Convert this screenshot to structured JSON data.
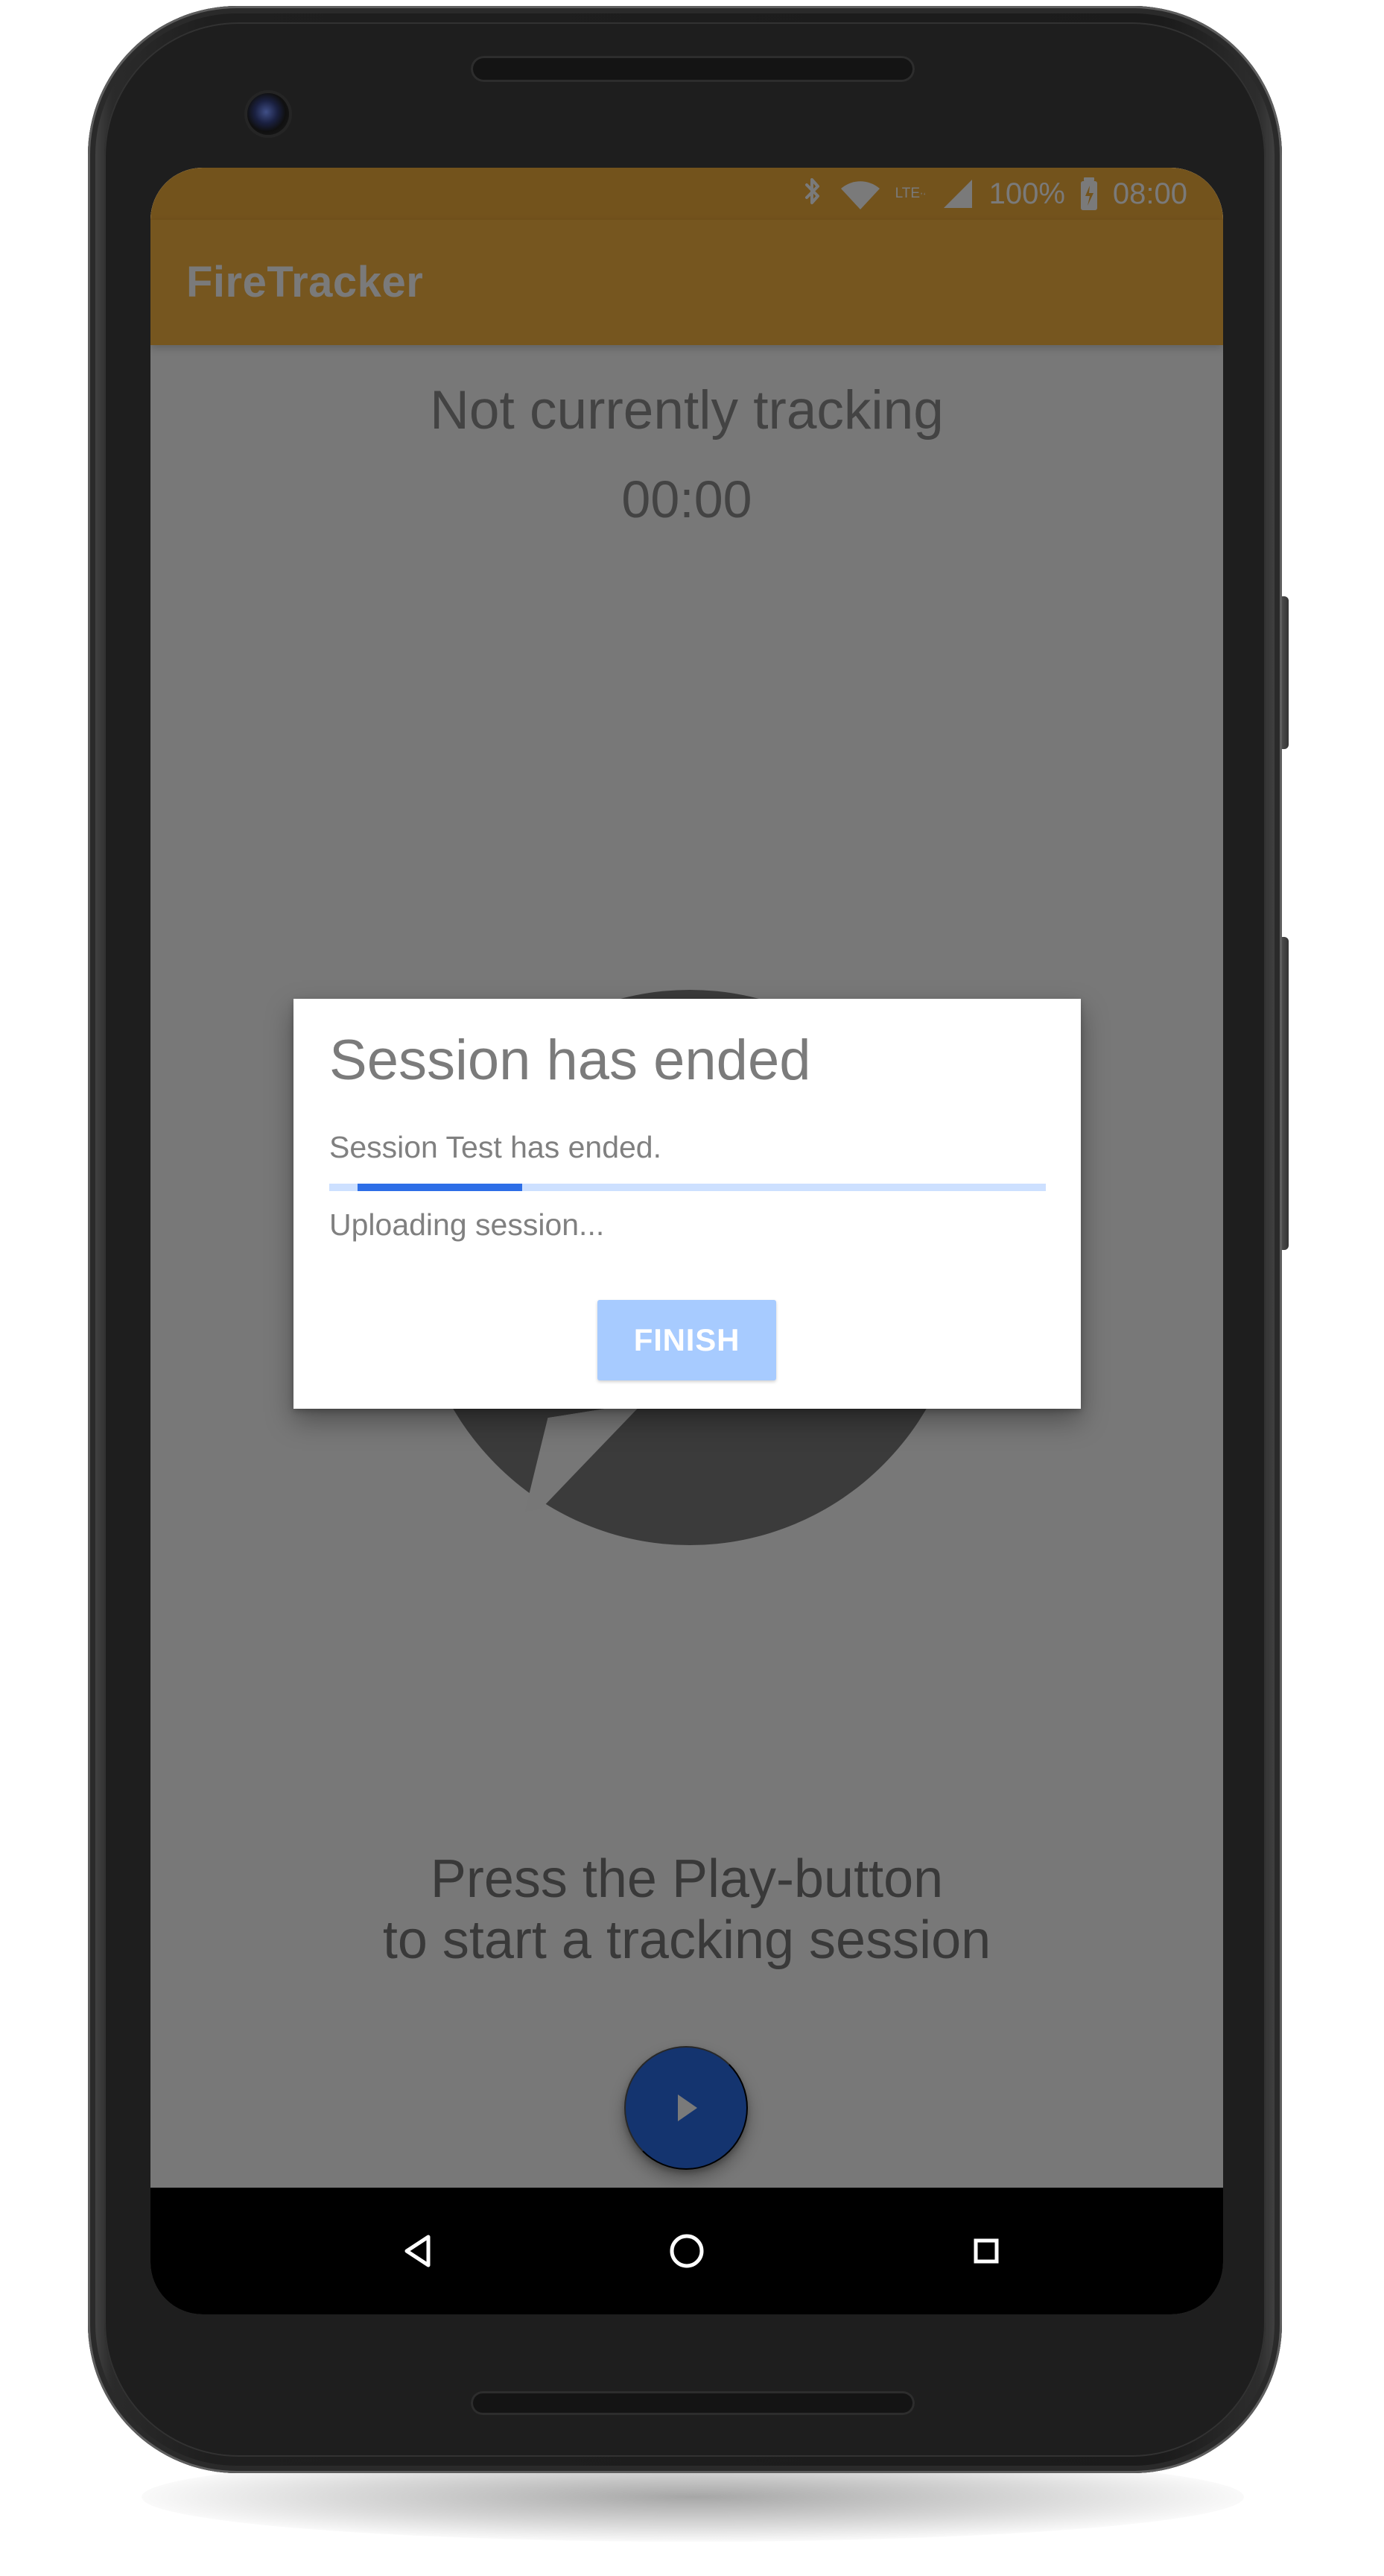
{
  "status_bar": {
    "icons": [
      "bluetooth-icon",
      "wifi-icon",
      "lte-icon",
      "cellular-signal-icon",
      "battery-charging-icon"
    ],
    "lte_text": "LTE",
    "battery_percent": "100%",
    "time": "08:00"
  },
  "app": {
    "title": "FireTracker",
    "tracking_status": "Not currently tracking",
    "timer": "00:00",
    "hint_line_1": "Press the Play-button",
    "hint_line_2": "to start a tracking session",
    "play_button_icon": "play-icon",
    "colors": {
      "status_bar": "#f1ad3c",
      "toolbar": "#f7b341",
      "fab": "#2b6ee8",
      "dialog_button": "#a7cbff",
      "progress": "#2d6ee7"
    }
  },
  "dialog": {
    "title": "Session has ended",
    "message": "Session Test has ended.",
    "progress_fraction": 0.23,
    "upload_status": "Uploading session...",
    "finish_label": "FINISH"
  },
  "navigation": {
    "back_icon": "back-triangle-icon",
    "home_icon": "home-circle-icon",
    "recents_icon": "recent-apps-square-icon"
  }
}
